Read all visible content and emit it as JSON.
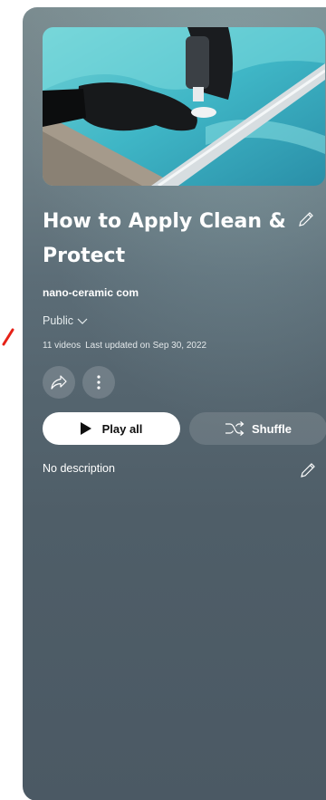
{
  "playlist": {
    "title": "How to Apply Clean & Protect",
    "owner": "nano-ceramic com",
    "privacy": "Public",
    "video_count": "11 videos",
    "last_updated": "Last updated on Sep 30, 2022",
    "description": "No description"
  },
  "actions": {
    "play_all_label": "Play all",
    "shuffle_label": "Shuffle"
  },
  "icons": {
    "edit_title": "pencil-icon",
    "privacy_dropdown": "chevron-down-icon",
    "share": "share-icon",
    "more": "more-vertical-icon",
    "play": "play-icon",
    "shuffle": "shuffle-icon",
    "edit_description": "pencil-icon"
  },
  "colors": {
    "accent_mark": "#e62117",
    "panel_top": "#7b8c90",
    "panel_bottom": "#4b5964",
    "play_button_bg": "#ffffff"
  }
}
